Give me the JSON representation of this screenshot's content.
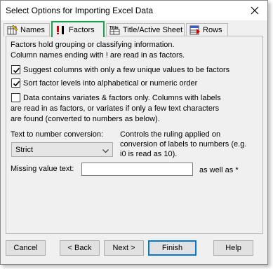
{
  "window": {
    "title": "Select Options for Importing Excel Data",
    "close_icon": "close-icon"
  },
  "tabs": [
    {
      "label": "Names",
      "icon": "names-icon",
      "active": false
    },
    {
      "label": "Factors",
      "icon": "factors-icon",
      "active": true
    },
    {
      "label": "Title/Active Sheet",
      "icon": "title-icon",
      "active": false
    },
    {
      "label": "Rows",
      "icon": "rows-icon",
      "active": false
    }
  ],
  "panel": {
    "intro_line1": "Factors hold grouping or classifying information.",
    "intro_line2": "Column names ending with ! are read in as factors.",
    "checkboxes": [
      {
        "label": "Suggest columns with only a few unique values to be factors",
        "checked": true
      },
      {
        "label": "Sort factor levels into alphabetical or numeric order",
        "checked": true
      },
      {
        "label_lines": [
          "Data contains variates & factors only. Columns with labels",
          "are read in as factors, or variates if only a few text characters",
          "are found (converted to numbers as below)."
        ],
        "checked": false
      }
    ],
    "conversion_label": "Text to number conversion:",
    "conversion_value": "Strict",
    "conversion_note_lines": [
      "Controls the ruling applied on",
      "conversion of labels to numbers (e.g.",
      "i0 is read as 10)."
    ],
    "missing_label": "Missing value text:",
    "missing_value": "",
    "missing_suffix": "as well as *"
  },
  "buttons": {
    "cancel": "Cancel",
    "back": "< Back",
    "next": "Next >",
    "finish": "Finish",
    "help": "Help"
  },
  "colors": {
    "active_tab_border": "#1aa14a",
    "default_button_border": "#0078d7"
  }
}
